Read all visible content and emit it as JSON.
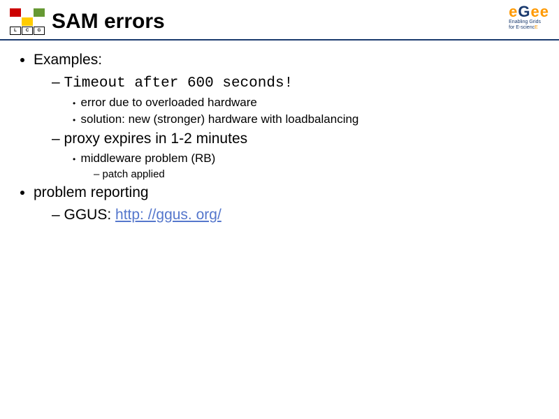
{
  "header": {
    "title": "SAM errors",
    "lcg_letters": [
      "L",
      "C",
      "G"
    ],
    "egee_main_parts": [
      "e",
      "G",
      "ee"
    ],
    "egee_sub_line1": "Enabling Grids",
    "egee_sub_line2_a": "for E-scienc",
    "egee_sub_line2_b": "E"
  },
  "content": {
    "b1": "Examples:",
    "b1_1": "Timeout after 600 seconds!",
    "b1_1_1": "error due to overloaded hardware",
    "b1_1_2": "solution: new (stronger) hardware with loadbalancing",
    "b1_2": "proxy expires in 1-2 minutes",
    "b1_2_1": "middleware problem (RB)",
    "b1_2_1_1": "patch applied",
    "b2": "problem reporting",
    "b2_1_prefix": "GGUS: ",
    "b2_1_link": "http: //ggus. org/"
  }
}
